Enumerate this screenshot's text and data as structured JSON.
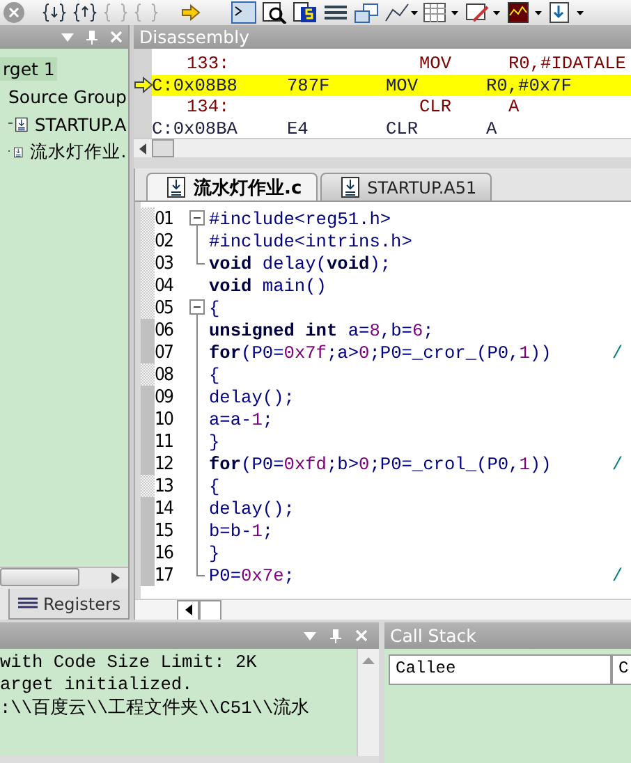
{
  "project": {
    "items": [
      {
        "label": "rget 1",
        "selected": true,
        "children": [
          {
            "label": "Source Group",
            "selected": false,
            "children": [
              {
                "label": "STARTUP.A",
                "selected": false
              },
              {
                "label": "流水灯作业.",
                "selected": false
              }
            ]
          }
        ]
      }
    ]
  },
  "left_tabs": [
    {
      "label": "Registers",
      "selected": false
    }
  ],
  "disassembly": {
    "title": "Disassembly",
    "rows": [
      {
        "kind": "source",
        "line": "133:",
        "mnemonic": "MOV",
        "operand": "R0,#IDATALE",
        "current": false
      },
      {
        "kind": "asm",
        "address": "C:0x08B8",
        "code": "787F",
        "mnemonic": "MOV",
        "operand": "R0,#0x7F",
        "current": true
      },
      {
        "kind": "source",
        "line": "134:",
        "mnemonic": "CLR",
        "operand": "A",
        "current": false
      },
      {
        "kind": "asm",
        "address": "C:0x08BA",
        "code": "E4",
        "mnemonic": "CLR",
        "operand": "A",
        "current": false
      }
    ]
  },
  "editor": {
    "tabs": [
      {
        "label": "流水灯作业.c",
        "selected": true
      },
      {
        "label": "STARTUP.A51",
        "selected": false
      }
    ],
    "lines": [
      {
        "number": "01",
        "fold_toggle": true,
        "in_fold": false,
        "marked": false,
        "tokens": [
          {
            "t": "#include<reg51.h>",
            "kind": "id"
          }
        ]
      },
      {
        "number": "02",
        "fold_toggle": false,
        "in_fold": true,
        "marked": false,
        "tokens": [
          {
            "t": "#include<intrins.h>",
            "kind": "id"
          }
        ]
      },
      {
        "number": "03",
        "fold_toggle": false,
        "in_fold": true,
        "marked": false,
        "tokens": [
          {
            "t": "void",
            "kind": "kw"
          },
          {
            "t": " delay(",
            "kind": "id"
          },
          {
            "t": "void",
            "kind": "kw"
          },
          {
            "t": ");",
            "kind": "id"
          }
        ]
      },
      {
        "number": "04",
        "fold_toggle": false,
        "in_fold": false,
        "marked": false,
        "tokens": [
          {
            "t": "void",
            "kind": "kw"
          },
          {
            "t": " main()",
            "kind": "id"
          }
        ]
      },
      {
        "number": "05",
        "fold_toggle": true,
        "in_fold": false,
        "marked": false,
        "tokens": [
          {
            "t": "{",
            "kind": "id"
          }
        ]
      },
      {
        "number": "06",
        "fold_toggle": false,
        "in_fold": true,
        "marked": true,
        "tokens": [
          {
            "t": "unsigned int",
            "kind": "kw"
          },
          {
            "t": " a=",
            "kind": "id"
          },
          {
            "t": "8",
            "kind": "num"
          },
          {
            "t": ",b=",
            "kind": "id"
          },
          {
            "t": "6",
            "kind": "num"
          },
          {
            "t": ";",
            "kind": "id"
          }
        ]
      },
      {
        "number": "07",
        "fold_toggle": false,
        "in_fold": true,
        "marked": true,
        "comment": "/",
        "tokens": [
          {
            "t": "for",
            "kind": "kw"
          },
          {
            "t": "(P0=",
            "kind": "id"
          },
          {
            "t": "0x7f",
            "kind": "num"
          },
          {
            "t": ";a>",
            "kind": "id"
          },
          {
            "t": "0",
            "kind": "num"
          },
          {
            "t": ";P0=_cror_(P0,",
            "kind": "id"
          },
          {
            "t": "1",
            "kind": "num"
          },
          {
            "t": "))",
            "kind": "id"
          }
        ]
      },
      {
        "number": "08",
        "fold_toggle": false,
        "in_fold": true,
        "marked": false,
        "tokens": [
          {
            "t": "{",
            "kind": "id"
          }
        ]
      },
      {
        "number": "09",
        "fold_toggle": false,
        "in_fold": true,
        "marked": true,
        "tokens": [
          {
            "t": "delay();",
            "kind": "id"
          }
        ]
      },
      {
        "number": "10",
        "fold_toggle": false,
        "in_fold": true,
        "marked": true,
        "tokens": [
          {
            "t": "a=a-",
            "kind": "id"
          },
          {
            "t": "1",
            "kind": "num"
          },
          {
            "t": ";",
            "kind": "id"
          }
        ]
      },
      {
        "number": "11",
        "fold_toggle": false,
        "in_fold": true,
        "marked": true,
        "tokens": [
          {
            "t": "}",
            "kind": "id"
          }
        ]
      },
      {
        "number": "12",
        "fold_toggle": false,
        "in_fold": true,
        "marked": true,
        "comment": "/",
        "tokens": [
          {
            "t": "for",
            "kind": "kw"
          },
          {
            "t": "(P0=",
            "kind": "id"
          },
          {
            "t": "0xfd",
            "kind": "num"
          },
          {
            "t": ";b>",
            "kind": "id"
          },
          {
            "t": "0",
            "kind": "num"
          },
          {
            "t": ";P0=_crol_(P0,",
            "kind": "id"
          },
          {
            "t": "1",
            "kind": "num"
          },
          {
            "t": "))",
            "kind": "id"
          }
        ]
      },
      {
        "number": "13",
        "fold_toggle": false,
        "in_fold": true,
        "marked": false,
        "tokens": [
          {
            "t": "{",
            "kind": "id"
          }
        ]
      },
      {
        "number": "14",
        "fold_toggle": false,
        "in_fold": true,
        "marked": true,
        "tokens": [
          {
            "t": "delay();",
            "kind": "id"
          }
        ]
      },
      {
        "number": "15",
        "fold_toggle": false,
        "in_fold": true,
        "marked": true,
        "tokens": [
          {
            "t": "b=b-",
            "kind": "id"
          },
          {
            "t": "1",
            "kind": "num"
          },
          {
            "t": ";",
            "kind": "id"
          }
        ]
      },
      {
        "number": "16",
        "fold_toggle": false,
        "in_fold": true,
        "marked": true,
        "tokens": [
          {
            "t": "}",
            "kind": "id"
          }
        ]
      },
      {
        "number": "17",
        "fold_toggle": false,
        "in_fold": true,
        "marked": true,
        "comment": "/",
        "tokens": [
          {
            "t": "P0=",
            "kind": "id"
          },
          {
            "t": "0x7e",
            "kind": "num"
          },
          {
            "t": ";",
            "kind": "id"
          }
        ]
      }
    ]
  },
  "output": {
    "lines": [
      "with Code Size Limit: 2K",
      "arget initialized.",
      ":\\\\百度云\\\\工程文件夹\\\\C51\\\\流水"
    ]
  },
  "call_stack": {
    "title": "Call Stack",
    "columns": [
      "Callee",
      "C"
    ]
  }
}
